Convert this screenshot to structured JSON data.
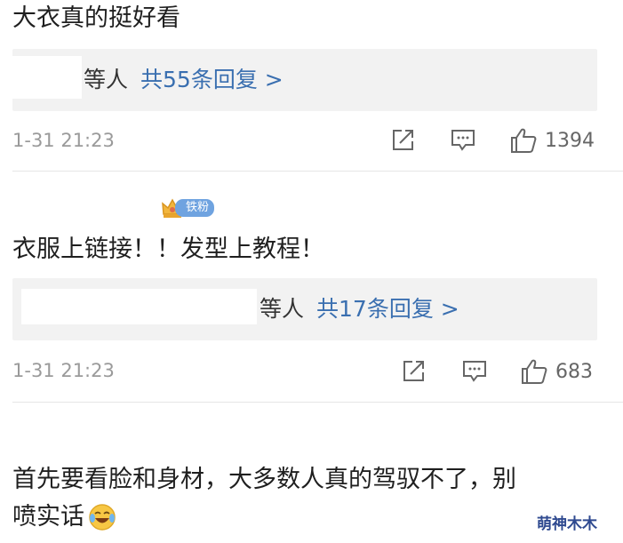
{
  "comments": [
    {
      "text": "大衣真的挺好看",
      "reply_suffix": "等人",
      "reply_link": "共55条回复 >",
      "time": "1-31 21:23",
      "likes": "1394"
    },
    {
      "badge": "铁粉",
      "text": "衣服上链接！！发型上教程！",
      "reply_suffix": "等人",
      "reply_link": "共17条回复 >",
      "time": "1-31 21:23",
      "likes": "683"
    },
    {
      "text_line1": "首先要看脸和身材，大多数人真的驾驭不了，别",
      "text_line2": "喷实话"
    }
  ],
  "icons": {
    "share": "share-icon",
    "comment": "comment-icon",
    "like": "thumb-up-icon",
    "emoji": "laugh-cry-emoji",
    "crown": "crown-icon"
  },
  "watermark": "萌神木木",
  "colors": {
    "link": "#3a6fb0",
    "meta": "#9a9a9a",
    "reply_bg": "#f2f2f2",
    "badge": "#6fa3e0"
  }
}
